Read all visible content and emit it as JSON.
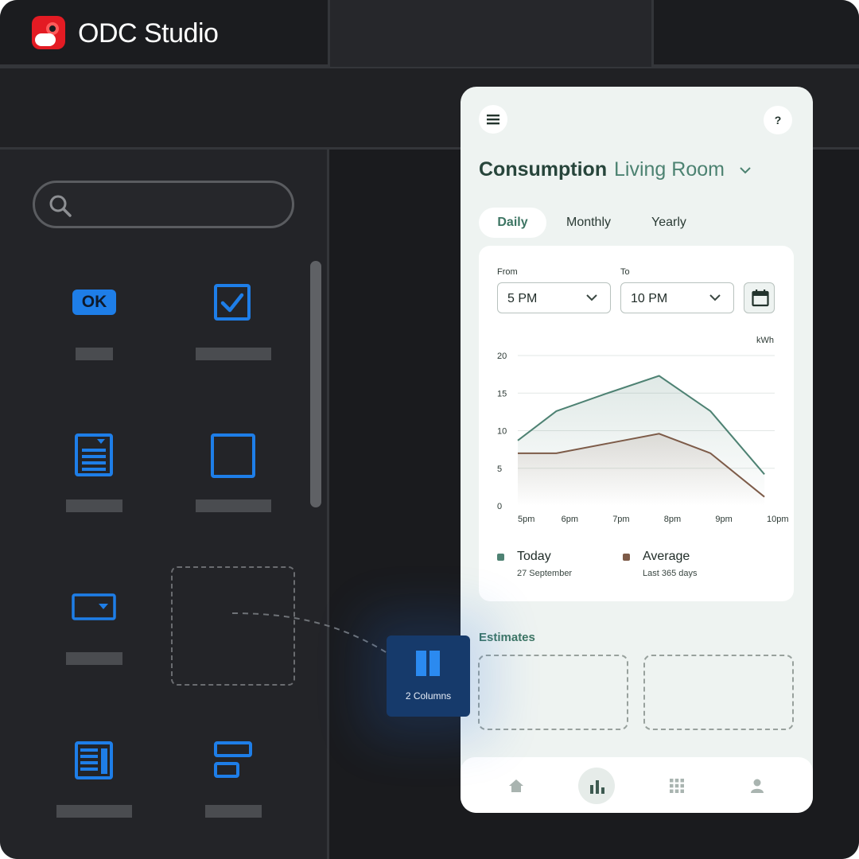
{
  "app": {
    "title": "ODC Studio"
  },
  "sidebar": {
    "search": {
      "placeholder": ""
    },
    "widgets": [
      {
        "name": "button",
        "badge": "OK"
      },
      {
        "name": "checkbox"
      },
      {
        "name": "form"
      },
      {
        "name": "container"
      },
      {
        "name": "dropdown"
      },
      {
        "name": "drop-target"
      },
      {
        "name": "card"
      },
      {
        "name": "list"
      }
    ]
  },
  "drag": {
    "label": "2 Columns"
  },
  "phone": {
    "heading": "Consumption",
    "location": "Living Room",
    "help_label": "?",
    "tabs": {
      "daily": "Daily",
      "monthly": "Monthly",
      "yearly": "Yearly"
    },
    "filters": {
      "from_label": "From",
      "from_value": "5 PM",
      "to_label": "To",
      "to_value": "10 PM"
    },
    "legend": {
      "today": {
        "name": "Today",
        "sub": "27 September"
      },
      "average": {
        "name": "Average",
        "sub": "Last 365 days"
      }
    },
    "estimates_title": "Estimates",
    "nav": [
      "home-icon",
      "chart-icon",
      "grid-icon",
      "profile-icon"
    ]
  },
  "colors": {
    "today": "#4e8273",
    "average": "#7d5b48",
    "accent": "#1e7ee8",
    "drag_tile": "#163a6b"
  },
  "chart_data": {
    "type": "line",
    "unit": "kWh",
    "x": [
      "5pm",
      "6pm",
      "7pm",
      "8pm",
      "9pm",
      "10pm"
    ],
    "ylim": [
      0,
      20
    ],
    "yticks": [
      "0",
      "5",
      "10",
      "15",
      "20"
    ],
    "series": [
      {
        "name": "Today",
        "x": [
          5,
          5.75,
          6.75,
          7.75,
          8.75,
          9.8
        ],
        "values": [
          8.7,
          12.6,
          15.0,
          17.3,
          12.6,
          4.2
        ]
      },
      {
        "name": "Average",
        "x": [
          5,
          5.75,
          6.75,
          7.75,
          8.75,
          9.8
        ],
        "values": [
          7.0,
          7.0,
          8.3,
          9.6,
          7.0,
          1.2
        ]
      }
    ]
  }
}
